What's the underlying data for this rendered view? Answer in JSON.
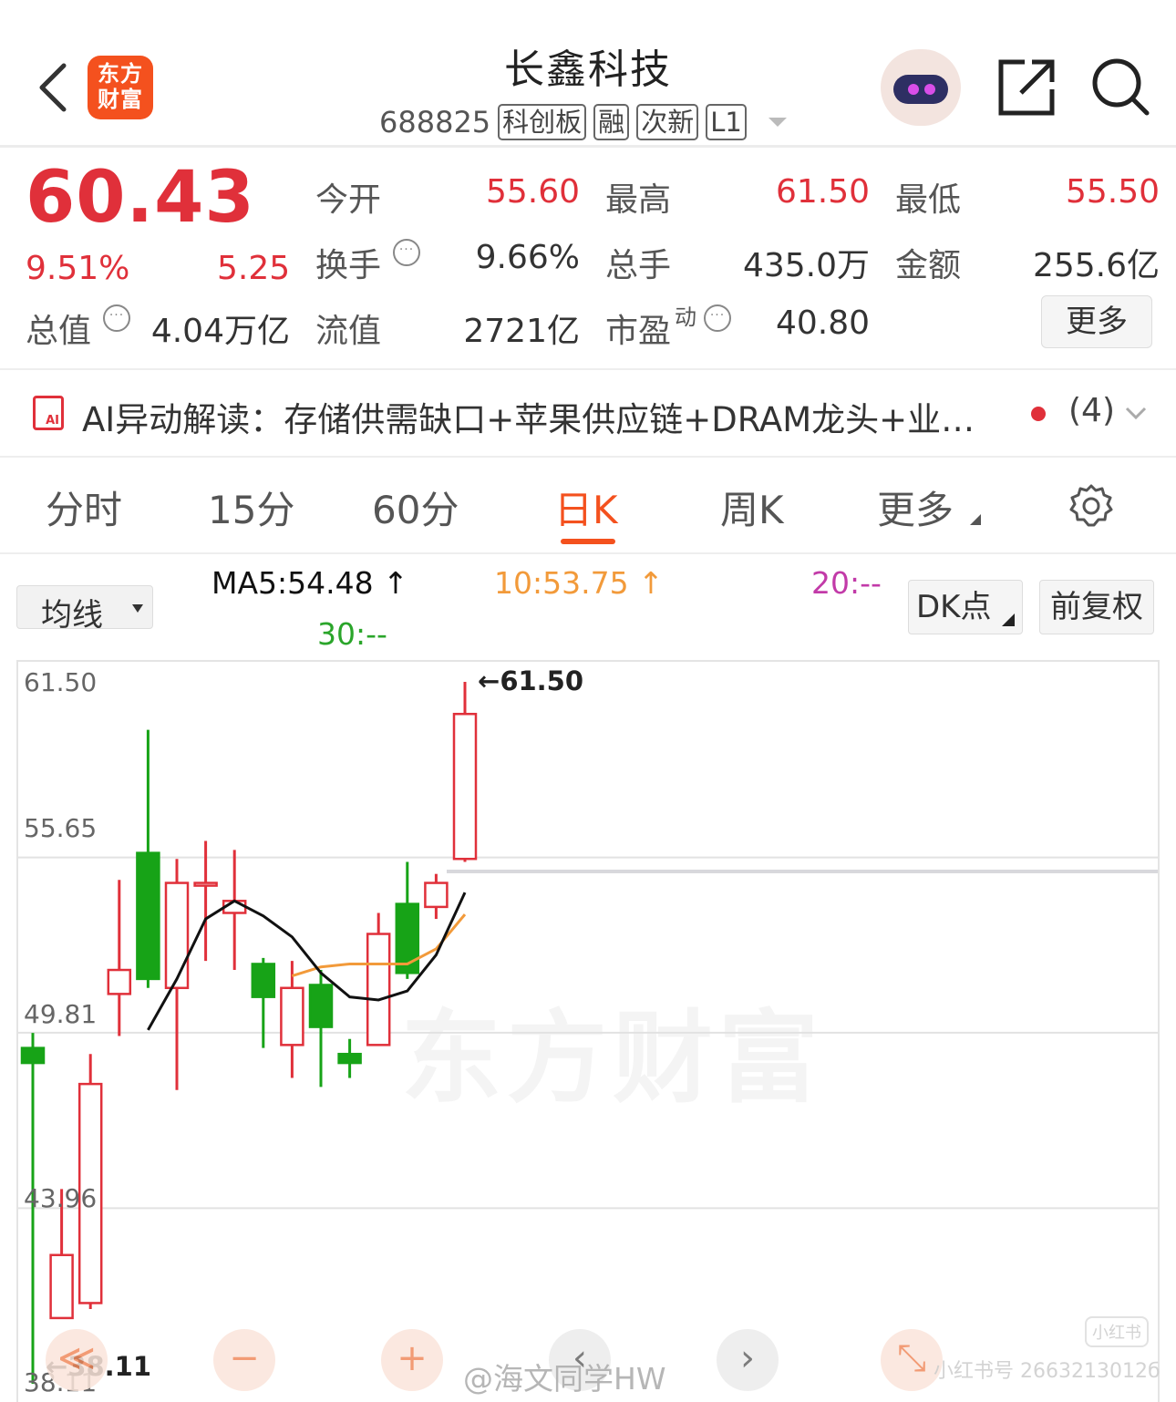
{
  "header": {
    "brand": "东方财富",
    "stock_name": "长鑫科技",
    "code": "688825",
    "tags": [
      "科创板",
      "融",
      "次新",
      "L1"
    ]
  },
  "quote": {
    "price": "60.43",
    "change_pct": "9.51%",
    "change": "5.25",
    "market_cap_label": "总值",
    "market_cap": "4.04万亿",
    "rows": [
      [
        {
          "label": "今开",
          "value": "55.60"
        },
        {
          "label": "最高",
          "value": "61.50"
        },
        {
          "label": "最低",
          "value": "55.50"
        }
      ],
      [
        {
          "label": "换手",
          "value": "9.66%"
        },
        {
          "label": "总手",
          "value": "435.0万"
        },
        {
          "label": "金额",
          "value": "255.6亿"
        }
      ],
      [
        {
          "label": "流值",
          "value": "2721亿"
        },
        {
          "label": "市盈",
          "value": "40.80"
        }
      ]
    ],
    "pe_sup": "动",
    "more": "更多"
  },
  "ai_banner": {
    "text": "AI异动解读：存储供需缺口+苹果供应链+DRAM龙头+业…",
    "count": "(4)",
    "icon_text": "AI"
  },
  "tabs": [
    "分时",
    "15分",
    "60分",
    "日K",
    "周K",
    "更多"
  ],
  "active_tab": "日K",
  "ma": {
    "selector": "均线",
    "ma5": "MA5:54.48 ↑",
    "ma10": "10:53.75 ↑",
    "ma20": "20:--",
    "ma30": "30:--",
    "dk": "DK点",
    "fq": "前复权"
  },
  "colors": {
    "up": "#e0303a",
    "down": "#17a317",
    "accent": "#f4511e",
    "ma5": "#111111",
    "ma10": "#f29a3a",
    "ma20": "#c23aa8",
    "ma30": "#2aa52a"
  },
  "chart_data": {
    "type": "candlestick",
    "y_ticks": [
      "61.50",
      "55.65",
      "49.81",
      "43.96",
      "38.11"
    ],
    "ylim": [
      38.11,
      61.5
    ],
    "high_label": "61.50",
    "low_label": "38.11",
    "watermark": "东方财富",
    "candles": [
      {
        "open": 49.3,
        "close": 48.8,
        "high": 49.8,
        "low": 38.11
      },
      {
        "open": 40.3,
        "close": 42.4,
        "high": 44.6,
        "low": 40.3
      },
      {
        "open": 40.8,
        "close": 48.1,
        "high": 49.1,
        "low": 40.6
      },
      {
        "open": 51.1,
        "close": 51.9,
        "high": 54.9,
        "low": 49.7
      },
      {
        "open": 55.8,
        "close": 51.6,
        "high": 59.9,
        "low": 51.3
      },
      {
        "open": 51.3,
        "close": 54.8,
        "high": 55.6,
        "low": 47.9
      },
      {
        "open": 54.8,
        "close": 54.8,
        "high": 56.2,
        "low": 52.2
      },
      {
        "open": 53.8,
        "close": 54.2,
        "high": 55.9,
        "low": 51.9
      },
      {
        "open": 52.1,
        "close": 51.0,
        "high": 52.3,
        "low": 49.3
      },
      {
        "open": 49.4,
        "close": 51.3,
        "high": 52.2,
        "low": 48.3
      },
      {
        "open": 51.4,
        "close": 50.0,
        "high": 51.9,
        "low": 48.0
      },
      {
        "open": 49.1,
        "close": 48.8,
        "high": 49.6,
        "low": 48.3
      },
      {
        "open": 49.4,
        "close": 53.1,
        "high": 53.8,
        "low": 49.4
      },
      {
        "open": 54.1,
        "close": 51.8,
        "high": 55.5,
        "low": 51.6
      },
      {
        "open": 54.0,
        "close": 54.8,
        "high": 55.1,
        "low": 53.6
      },
      {
        "open": 55.6,
        "close": 60.43,
        "high": 61.5,
        "low": 55.5
      }
    ],
    "ma5_line": [
      null,
      null,
      null,
      null,
      49.9,
      51.6,
      53.6,
      54.2,
      53.7,
      53.0,
      51.8,
      51.0,
      50.9,
      51.2,
      52.4,
      54.48
    ],
    "ma10_line": [
      null,
      null,
      null,
      null,
      null,
      null,
      null,
      null,
      null,
      51.7,
      52.0,
      52.1,
      52.1,
      52.1,
      52.6,
      53.75
    ],
    "prev_close": 55.18
  },
  "bottom": {
    "controls": [
      "≪",
      "−",
      "+",
      "‹",
      "›",
      "⤡"
    ],
    "weibo": "@海文同学HW",
    "xhs_id": "小红书号 2663213012б",
    "xhs_logo": "小红书"
  }
}
